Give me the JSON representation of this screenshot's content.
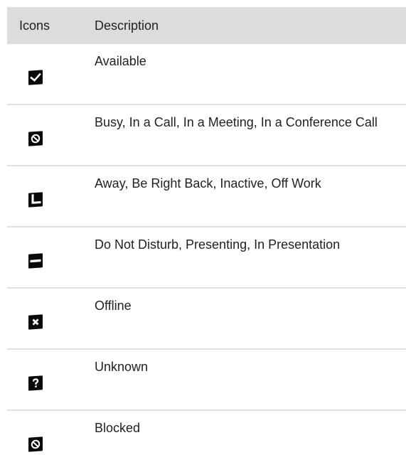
{
  "table": {
    "headers": {
      "icons": "Icons",
      "description": "Description"
    },
    "rows": [
      {
        "icon": "available-check-icon",
        "description": "Available"
      },
      {
        "icon": "busy-circle-slash-icon",
        "description": "Busy, In a Call, In a Meeting, In a Conference Call"
      },
      {
        "icon": "away-clock-icon",
        "description": "Away, Be Right Back, Inactive, Off Work"
      },
      {
        "icon": "do-not-disturb-minus-icon",
        "description": "Do Not Disturb, Presenting, In Presentation"
      },
      {
        "icon": "offline-x-icon",
        "description": "Offline"
      },
      {
        "icon": "unknown-question-icon",
        "description": "Unknown"
      },
      {
        "icon": "blocked-circle-slash-icon",
        "description": "Blocked"
      }
    ]
  }
}
